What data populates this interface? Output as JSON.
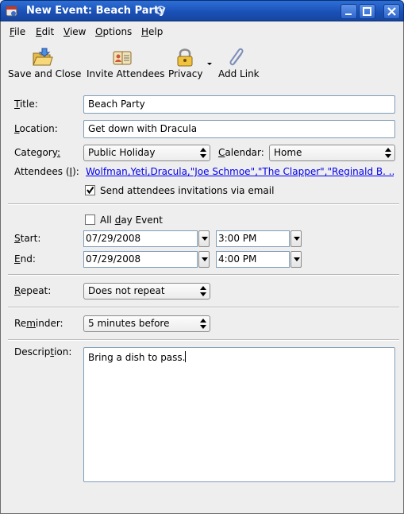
{
  "window": {
    "title": "New Event: Beach Party"
  },
  "menubar": {
    "items": [
      {
        "label": "File",
        "mnemonic": "F",
        "rest": "ile"
      },
      {
        "label": "Edit",
        "mnemonic": "E",
        "rest": "dit"
      },
      {
        "label": "View",
        "mnemonic": "V",
        "rest": "iew"
      },
      {
        "label": "Options",
        "mnemonic": "O",
        "rest": "ptions"
      },
      {
        "label": "Help",
        "mnemonic": "H",
        "rest": "elp"
      }
    ]
  },
  "toolbar": {
    "save_close": "Save and Close",
    "invite": "Invite Attendees",
    "privacy": "Privacy",
    "add_link": "Add Link"
  },
  "form": {
    "title_label_m": "T",
    "title_label_rest": "itle:",
    "title_value": "Beach Party",
    "location_label_m": "L",
    "location_label_rest": "ocation:",
    "location_value": "Get down with Dracula",
    "category_label_pre": "Category",
    "category_label_m": ":",
    "category_label": "Category:",
    "category_value": "Public Holiday",
    "calendar_label_m": "C",
    "calendar_label_rest": "alendar:",
    "calendar_value": "Home",
    "attendees_label_pre": "Attendees (",
    "attendees_label_m": "I",
    "attendees_label_post": "):",
    "attendees_value": "Wolfman,Yeti,Dracula,\"Joe Schmoe\",\"The Clapper\",\"Reginald B. ...",
    "send_invites_label": "Send attendees invitations via email",
    "send_invites_checked": true,
    "allday_label_pre": "All ",
    "allday_label_m": "d",
    "allday_label_post": "ay Event",
    "allday_checked": false,
    "start_label_m": "S",
    "start_label_rest": "tart:",
    "start_date": "07/29/2008",
    "start_time": "3:00 PM",
    "end_label_m": "E",
    "end_label_rest": "nd:",
    "end_date": "07/29/2008",
    "end_time": "4:00 PM",
    "repeat_label_m": "R",
    "repeat_label_rest": "epeat:",
    "repeat_value": "Does not repeat",
    "reminder_label_pre": "Re",
    "reminder_label_m": "m",
    "reminder_label_post": "inder:",
    "reminder_value": "5 minutes before",
    "description_label_pre": "Descrip",
    "description_label_m": "t",
    "description_label_post": "ion:",
    "description_value": "Bring a dish to pass."
  }
}
